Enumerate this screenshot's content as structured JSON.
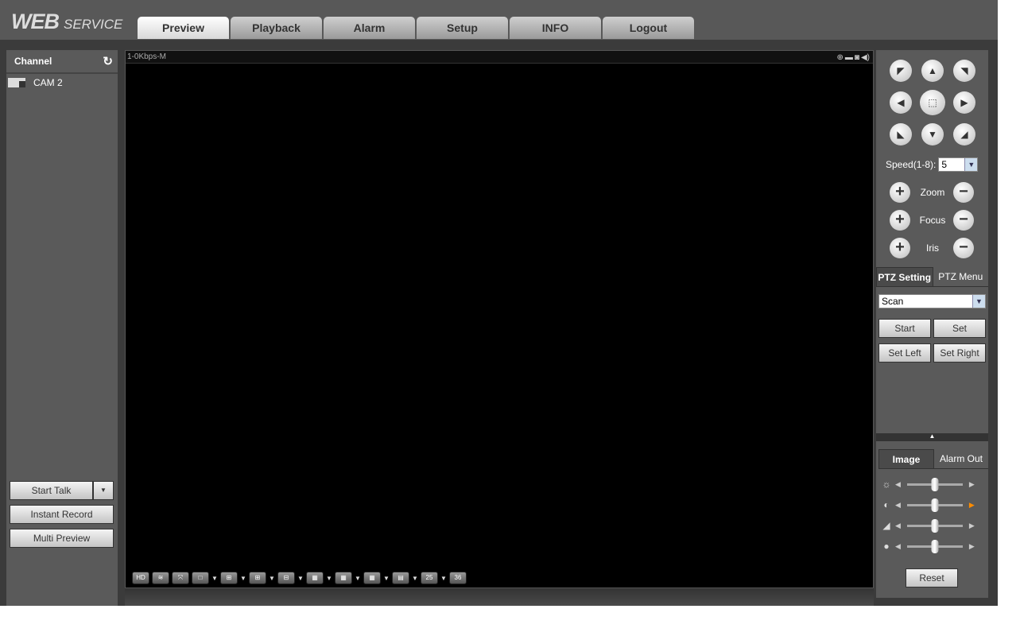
{
  "header": {
    "logo_main": "WEB",
    "logo_sub": "SERVICE",
    "tabs": [
      "Preview",
      "Playback",
      "Alarm",
      "Setup",
      "INFO",
      "Logout"
    ],
    "active_tab": "Preview"
  },
  "channel": {
    "title": "Channel",
    "refresh_icon": "refresh-icon",
    "items": [
      {
        "label": "CAM 2"
      }
    ]
  },
  "left_buttons": {
    "start_talk": "Start Talk",
    "instant_record": "Instant Record",
    "multi_preview": "Multi Preview"
  },
  "video": {
    "status": "1-0Kbps-M",
    "toolbar": [
      "HD",
      "fluency",
      "fullscreen",
      "1",
      "4",
      "6",
      "8",
      "9",
      "13",
      "16",
      "20",
      "25",
      "36"
    ]
  },
  "ptz": {
    "speed_label": "Speed(1-8):",
    "speed_value": "5",
    "zoom": "Zoom",
    "focus": "Focus",
    "iris": "Iris",
    "tabs": [
      "PTZ Setting",
      "PTZ Menu"
    ],
    "mode": "Scan",
    "buttons": [
      "Start",
      "Set",
      "Set Left",
      "Set Right"
    ]
  },
  "image": {
    "tabs": [
      "Image",
      "Alarm Out"
    ],
    "sliders": [
      {
        "name": "brightness",
        "value": 50
      },
      {
        "name": "contrast",
        "value": 50
      },
      {
        "name": "saturation",
        "value": 50
      },
      {
        "name": "hue",
        "value": 50
      }
    ],
    "reset": "Reset",
    "highlight_color": "#ff8c00"
  }
}
